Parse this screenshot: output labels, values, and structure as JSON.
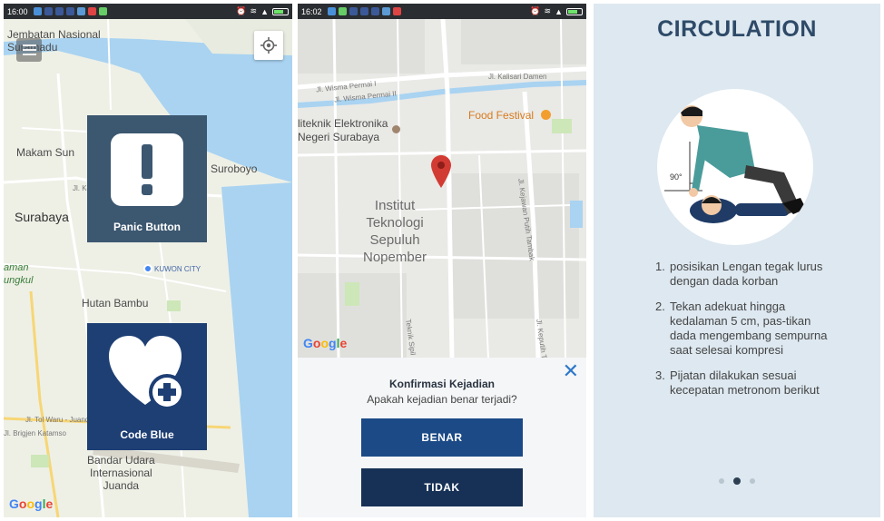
{
  "screen1": {
    "status_time": "16:00",
    "map_labels": {
      "jembatan": "Jembatan Nasional\nSuramadu",
      "makam": "Makam Sun",
      "suroboyo": "Suroboyo",
      "surabaya": "Surabaya",
      "kuwon": "KUWON CITY",
      "hutan": "Hutan Bambu",
      "amaan": "aman\nungkul",
      "tol": "Jl. Tol Waru - Juanda",
      "brigjen": "Jl. Brigjen Katamso",
      "bandara": "Bandar Udara\nInternasional\nJuanda",
      "keputih": "Jl. Kej"
    },
    "panic_label": "Panic Button",
    "codeblue_label": "Code Blue",
    "google": "Google"
  },
  "screen2": {
    "status_time": "16:02",
    "map_labels": {
      "wisma1": "Jl. Wisma Permai I",
      "wisma2": "Jl. Wisma Permai II",
      "kalisari": "Jl. Kalisari Damen",
      "politeknik": "liteknik Elektronika\nNegeri Surabaya",
      "food": "Food Festival",
      "its": "Institut\nTeknologi\nSepuluh\nNopember",
      "kejawan": "Jl. Kejawan Putih Tambak",
      "teknik": "Teknik Sipil",
      "timur": "Jl. Keputih Timur"
    },
    "google": "Google",
    "confirm_title": "Konfirmasi Kejadian",
    "confirm_sub": "Apakah kejadian benar terjadi?",
    "benar_label": "BENAR",
    "tidak_label": "TIDAK",
    "close_glyph": "✕"
  },
  "screen3": {
    "title": "CIRCULATION",
    "angle_label": "90°",
    "steps": [
      {
        "num": "1.",
        "text": "posisikan Lengan tegak lurus dengan dada korban"
      },
      {
        "num": "2.",
        "text": "Tekan adekuat hingga kedalaman 5 cm, pas-tikan dada mengembang sempurna saat selesai kompresi"
      },
      {
        "num": "3.",
        "text": "Pijatan dilakukan sesuai kecepatan metronom berikut"
      }
    ],
    "page_count": 3,
    "active_page": 2
  },
  "colors": {
    "panic_card": "#3c5770",
    "codeblue_card": "#1e3f74",
    "benar": "#1c4a86",
    "tidak": "#173156",
    "circ_bg": "#dde8f0"
  }
}
